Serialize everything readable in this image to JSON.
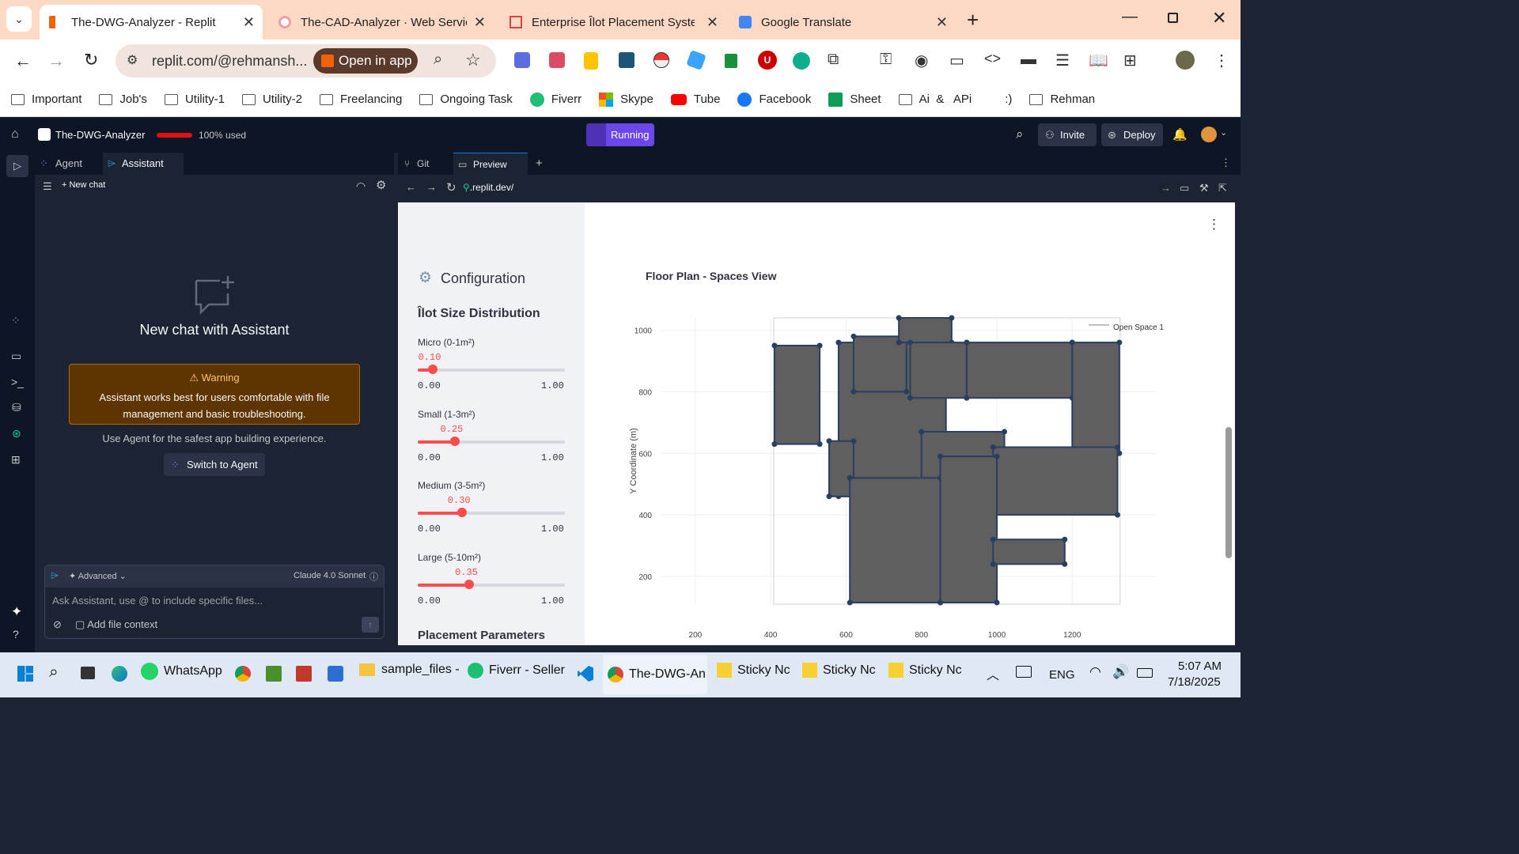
{
  "browser": {
    "tabs": [
      {
        "title": "The-DWG-Analyzer - Replit",
        "active": true
      },
      {
        "title": "The-CAD-Analyzer · Web Servic",
        "active": false
      },
      {
        "title": "Enterprise Îlot Placement Syster",
        "active": false
      },
      {
        "title": "Google Translate",
        "active": false
      }
    ],
    "url": "replit.com/@rehmansh...",
    "open_in_app": "Open in app",
    "bookmarks": [
      "Important",
      "Job's",
      "Utility-1",
      "Utility-2",
      "Freelancing",
      "Ongoing Task",
      "Fiverr",
      "Skype",
      "Tube",
      "Facebook",
      "Sheet",
      "Ai  &   APi",
      ":)",
      "Rehman"
    ]
  },
  "replit": {
    "project": "The-DWG-Analyzer",
    "usage": "100% used",
    "status": "Running",
    "invite": "Invite",
    "deploy": "Deploy",
    "left_tabs": [
      "Agent",
      "Assistant"
    ],
    "new_chat": "New chat",
    "empty_title": "New chat with Assistant",
    "warning_title": "Warning",
    "warning_text": "Assistant works best for users comfortable with file management and basic troubleshooting.",
    "agent_hint": "Use Agent for the safest app building experience.",
    "switch_agent": "Switch to Agent",
    "advanced": "Advanced",
    "model": "Claude 4.0 Sonnet",
    "input_placeholder": "Ask Assistant, use @ to include specific files...",
    "add_file": "Add file context",
    "ws_tabs": [
      "Git",
      "Preview"
    ],
    "preview_url": ".replit.dev/"
  },
  "app": {
    "config_title": "Configuration",
    "dist_title": "Îlot Size Distribution",
    "sliders": [
      {
        "label": "Micro (0-1m²)",
        "value": 0.1,
        "value_text": "0.10",
        "min": "0.00",
        "max": "1.00"
      },
      {
        "label": "Small (1-3m²)",
        "value": 0.25,
        "value_text": "0.25",
        "min": "0.00",
        "max": "1.00"
      },
      {
        "label": "Medium (3-5m²)",
        "value": 0.3,
        "value_text": "0.30",
        "min": "0.00",
        "max": "1.00"
      },
      {
        "label": "Large (5-10m²)",
        "value": 0.35,
        "value_text": "0.35",
        "min": "0.00",
        "max": "1.00"
      }
    ],
    "placement_title": "Placement Parameters",
    "chart_title": "Floor Plan - Spaces View"
  },
  "chart_data": {
    "type": "scatter",
    "title": "Floor Plan - Spaces View",
    "ylabel": "Y Coordinate (m)",
    "xlabel": "",
    "xticks": [
      200,
      400,
      600,
      800,
      1000,
      1200
    ],
    "yticks": [
      200,
      400,
      600,
      800,
      1000
    ],
    "xlim": [
      110,
      1340
    ],
    "ylim": [
      110,
      1040
    ],
    "legend": [
      "Open Space 1"
    ],
    "legend_position": "top-right",
    "fill_color": "#5f5f5f",
    "edge_color": "#2a3f5f",
    "polygons": [
      [
        [
          410,
          950
        ],
        [
          410,
          630
        ],
        [
          530,
          630
        ],
        [
          530,
          950
        ]
      ],
      [
        [
          580,
          960
        ],
        [
          580,
          460
        ],
        [
          865,
          460
        ],
        [
          865,
          960
        ]
      ],
      [
        [
          555,
          640
        ],
        [
          555,
          460
        ],
        [
          620,
          460
        ],
        [
          620,
          640
        ]
      ],
      [
        [
          620,
          980
        ],
        [
          620,
          800
        ],
        [
          760,
          800
        ],
        [
          760,
          980
        ]
      ],
      [
        [
          740,
          1040
        ],
        [
          740,
          960
        ],
        [
          880,
          960
        ],
        [
          880,
          1040
        ]
      ],
      [
        [
          770,
          960
        ],
        [
          770,
          780
        ],
        [
          920,
          780
        ],
        [
          920,
          960
        ]
      ],
      [
        [
          920,
          960
        ],
        [
          920,
          780
        ],
        [
          1200,
          780
        ],
        [
          1200,
          960
        ]
      ],
      [
        [
          1200,
          960
        ],
        [
          1200,
          600
        ],
        [
          1325,
          600
        ],
        [
          1325,
          960
        ]
      ],
      [
        [
          880,
          660
        ],
        [
          880,
          590
        ],
        [
          990,
          590
        ],
        [
          990,
          660
        ]
      ],
      [
        [
          800,
          670
        ],
        [
          800,
          500
        ],
        [
          1020,
          500
        ],
        [
          1020,
          670
        ]
      ],
      [
        [
          990,
          620
        ],
        [
          990,
          400
        ],
        [
          1320,
          400
        ],
        [
          1320,
          620
        ]
      ],
      [
        [
          610,
          520
        ],
        [
          610,
          115
        ],
        [
          850,
          115
        ],
        [
          850,
          520
        ]
      ],
      [
        [
          850,
          590
        ],
        [
          850,
          115
        ],
        [
          1000,
          115
        ],
        [
          1000,
          590
        ]
      ],
      [
        [
          990,
          320
        ],
        [
          990,
          240
        ],
        [
          1180,
          240
        ],
        [
          1180,
          320
        ]
      ]
    ]
  },
  "taskbar": {
    "items": [
      "WhatsApp",
      "sample_files -",
      "Fiverr - Seller",
      "The-DWG-An",
      "Sticky Nc",
      "Sticky Nc",
      "Sticky Nc"
    ],
    "lang": "ENG",
    "time": "5:07 AM",
    "date": "7/18/2025"
  }
}
